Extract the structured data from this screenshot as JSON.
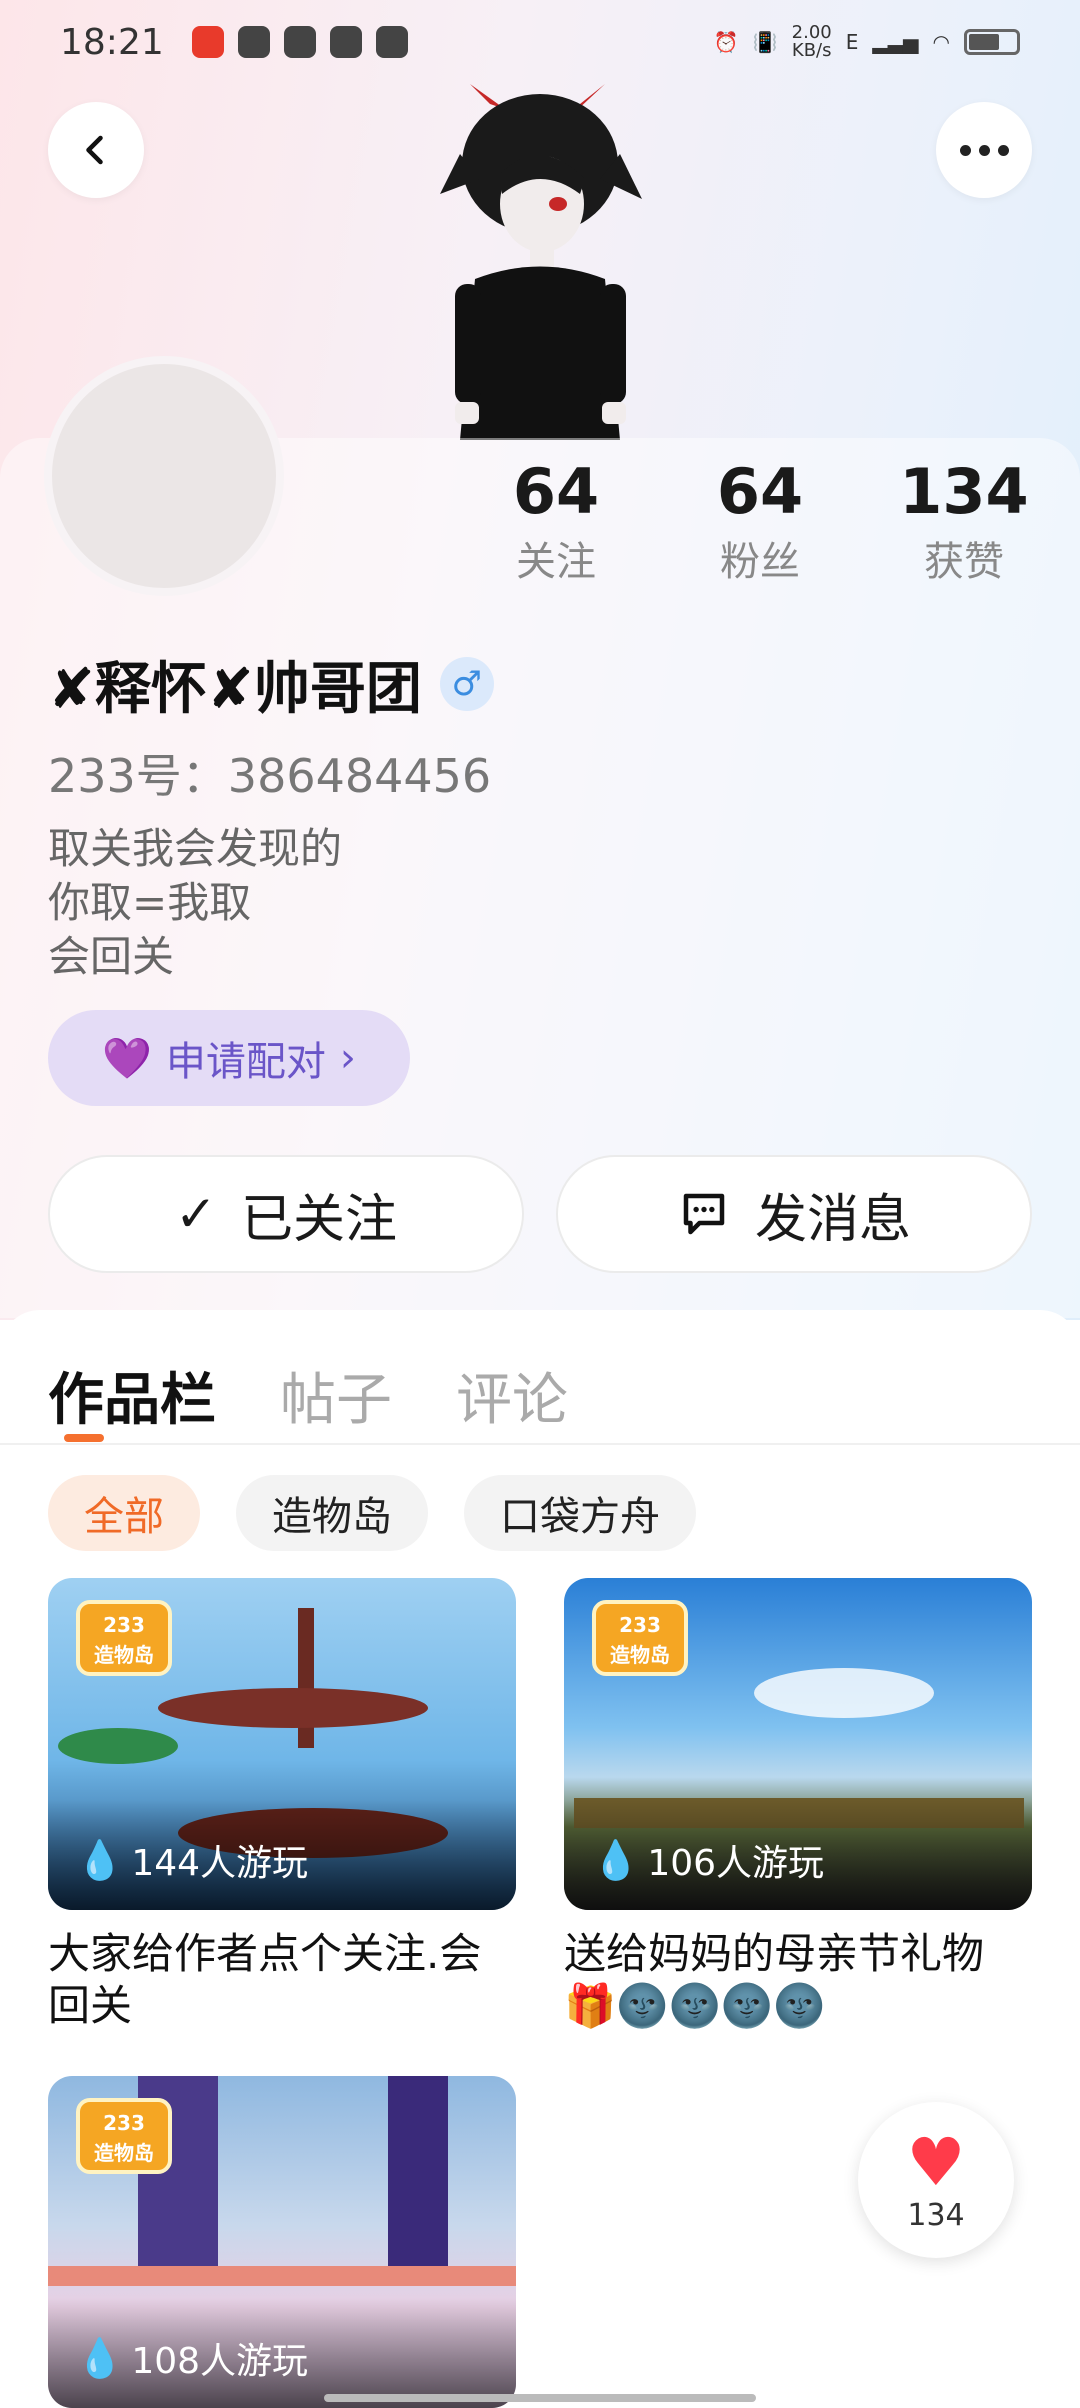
{
  "status_bar": {
    "time": "18:21",
    "net_speed": "2.00\nKB/s",
    "net_type": "E"
  },
  "profile": {
    "username": "✘释怀✘帅哥团",
    "gender_symbol": "♂",
    "id_line": "233号：386484456",
    "bio_lines": [
      "取关我会发现的",
      "你取=我取",
      "会回关"
    ],
    "stats": [
      {
        "value": "64",
        "label": "关注"
      },
      {
        "value": "64",
        "label": "粉丝"
      },
      {
        "value": "134",
        "label": "获赞"
      }
    ],
    "match_label": "申请配对",
    "follow_label": "已关注",
    "message_label": "发消息"
  },
  "tabs": [
    {
      "label": "作品栏",
      "active": true
    },
    {
      "label": "帖子",
      "active": false
    },
    {
      "label": "评论",
      "active": false
    }
  ],
  "filters": [
    {
      "label": "全部",
      "active": true
    },
    {
      "label": "造物岛",
      "active": false
    },
    {
      "label": "口袋方舟",
      "active": false
    }
  ],
  "works": [
    {
      "logo_text": "233\n造物岛",
      "plays": "144人游玩",
      "title": "大家给作者点个关注.会回关"
    },
    {
      "logo_text": "233\n造物岛",
      "plays": "106人游玩",
      "title": "送给妈妈的母亲节礼物🎁🌚🌚🌚🌚"
    },
    {
      "logo_text": "233\n造物岛",
      "plays": "108人游玩",
      "title": ""
    }
  ],
  "like_fab": {
    "count": "134"
  },
  "colors": {
    "accent_orange": "#f5702f",
    "match_purple": "#6a55c8",
    "like_red": "#ff3b4a"
  }
}
